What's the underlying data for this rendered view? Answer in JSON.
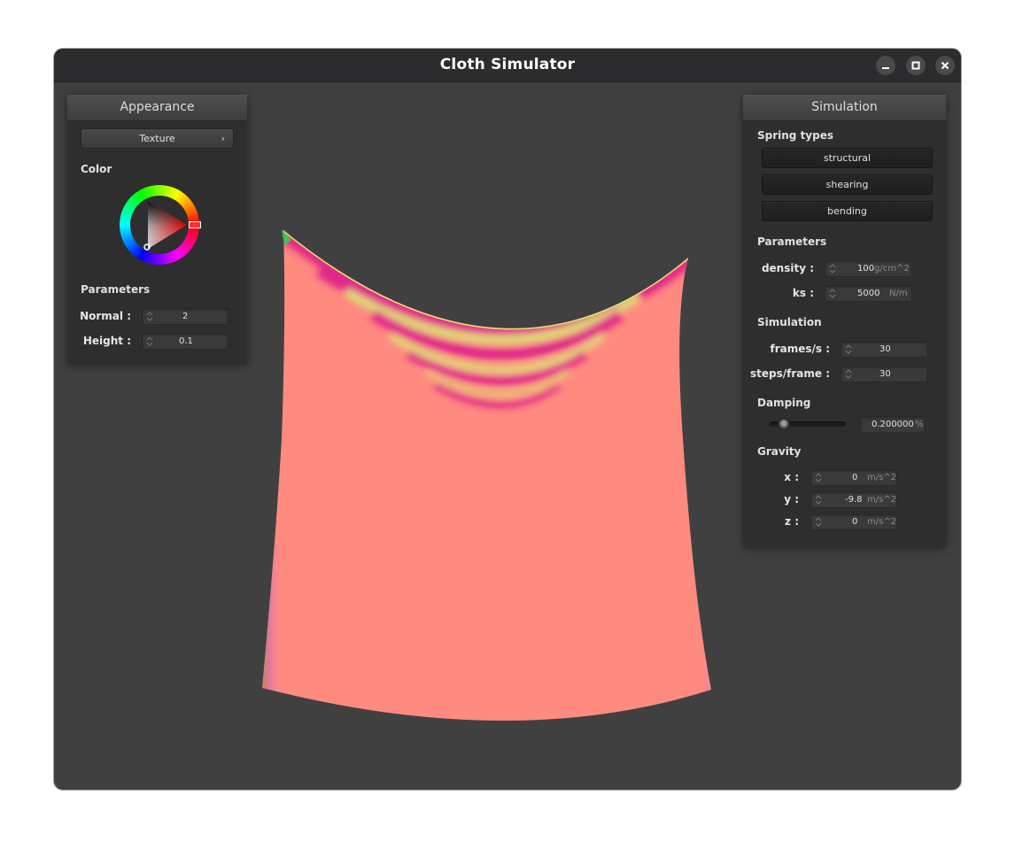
{
  "window": {
    "title": "Cloth Simulator"
  },
  "appearance": {
    "header": "Appearance",
    "texture_label": "Texture",
    "color_label": "Color",
    "parameters_label": "Parameters",
    "normal_label": "Normal :",
    "normal_value": "2",
    "height_label": "Height :",
    "height_value": "0.1",
    "selected_color": "#ff0000"
  },
  "simulation": {
    "header": "Simulation",
    "spring_types_label": "Spring types",
    "spring_buttons": [
      "structural",
      "shearing",
      "bending"
    ],
    "parameters_label": "Parameters",
    "density_label": "density :",
    "density_value": "100",
    "density_unit": "g/cm^2",
    "ks_label": "ks :",
    "ks_value": "5000",
    "ks_unit": "N/m",
    "simulation_label": "Simulation",
    "fps_label": "frames/s :",
    "fps_value": "30",
    "steps_label": "steps/frame :",
    "steps_value": "30",
    "damping_label": "Damping",
    "damping_value": "0.200000",
    "damping_unit": "%",
    "damping_level": 0.2,
    "gravity_label": "Gravity",
    "gx_label": "x :",
    "gx_value": "0",
    "gy_label": "y :",
    "gy_value": "-9.8",
    "gz_label": "z :",
    "gz_value": "0",
    "gravity_unit": "m/s^2"
  },
  "colors": {
    "background": "#404040",
    "panel": "#2e2e2e",
    "cloth": "#ff8a80",
    "cloth_stripe_magenta": "#e0208a",
    "cloth_stripe_yellow": "#d9e070"
  }
}
